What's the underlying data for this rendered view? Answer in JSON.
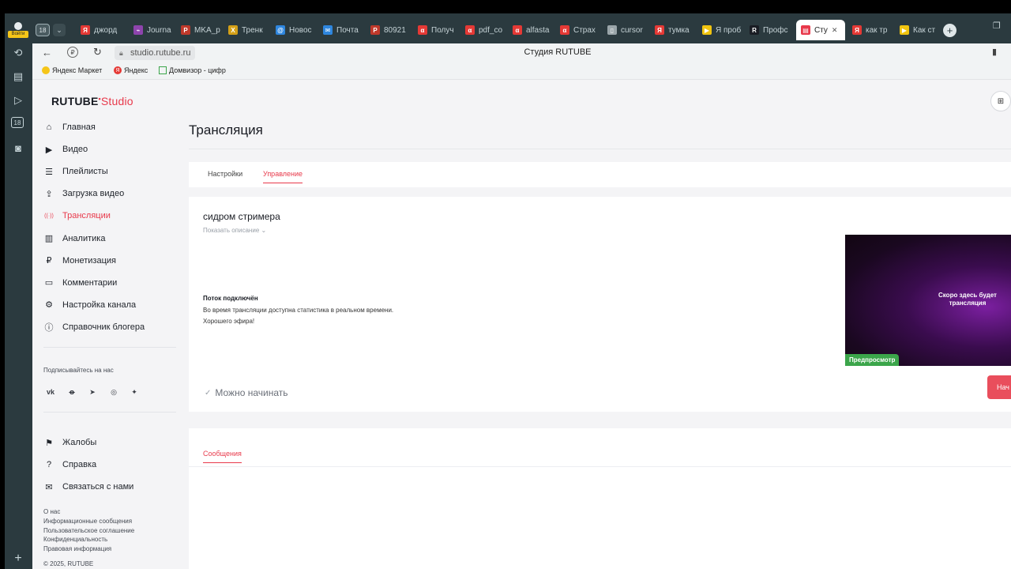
{
  "browser": {
    "profile_label": "Войти",
    "tab_counter": "18",
    "tabs": [
      {
        "label": "джорд",
        "icon": "yandex-icon",
        "color": "#e53935"
      },
      {
        "label": "Journa",
        "icon": "journal-icon",
        "color": "#8e44ad"
      },
      {
        "label": "MKA_р",
        "icon": "pdf-icon",
        "color": "#c0392b"
      },
      {
        "label": "Тренк",
        "icon": "translate-icon",
        "color": "#d4a017"
      },
      {
        "label": "Новос",
        "icon": "at-icon",
        "color": "#2e86de"
      },
      {
        "label": "Почта",
        "icon": "mail-icon",
        "color": "#2e86de"
      },
      {
        "label": "80921",
        "icon": "pdf-icon",
        "color": "#c0392b"
      },
      {
        "label": "Получ",
        "icon": "alfa-icon",
        "color": "#e53935"
      },
      {
        "label": "pdf_co",
        "icon": "alfa-icon",
        "color": "#e53935"
      },
      {
        "label": "alfasta",
        "icon": "alfa-icon",
        "color": "#e53935"
      },
      {
        "label": "Страх",
        "icon": "alfa-icon",
        "color": "#e53935"
      },
      {
        "label": "cursor",
        "icon": "doc-icon",
        "color": "#9aa5a9"
      },
      {
        "label": "тумка",
        "icon": "yandex-icon",
        "color": "#e53935"
      },
      {
        "label": "Я проб",
        "icon": "play-icon",
        "color": "#f1c40f"
      },
      {
        "label": "Профс",
        "icon": "r-icon",
        "color": "#1a1d24"
      },
      {
        "label": "Сту",
        "icon": "studio-icon",
        "color": "#e8394b",
        "active": true
      },
      {
        "label": "как тр",
        "icon": "yandex-icon",
        "color": "#e53935"
      },
      {
        "label": "Как ст",
        "icon": "play-icon",
        "color": "#f1c40f"
      }
    ],
    "url": "studio.rutube.ru",
    "page_title": "Студия RUTUBE",
    "bookmarks": [
      {
        "label": "Яндекс Маркет",
        "icon": "market-icon"
      },
      {
        "label": "Яндекс",
        "icon": "yandex-icon"
      },
      {
        "label": "Домвизор - цифр",
        "icon": "house-icon"
      }
    ]
  },
  "sidebar": {
    "logo_main": "RUTUBE",
    "logo_studio": "Studio",
    "nav": [
      {
        "label": "Главная",
        "icon": "home-icon"
      },
      {
        "label": "Видео",
        "icon": "video-icon"
      },
      {
        "label": "Плейлисты",
        "icon": "playlist-icon"
      },
      {
        "label": "Загрузка видео",
        "icon": "upload-icon"
      },
      {
        "label": "Трансляции",
        "icon": "broadcast-icon",
        "active": true
      },
      {
        "label": "Аналитика",
        "icon": "analytics-icon"
      },
      {
        "label": "Монетизация",
        "icon": "ruble-icon"
      },
      {
        "label": "Комментарии",
        "icon": "comment-icon"
      },
      {
        "label": "Настройка канала",
        "icon": "gear-icon"
      },
      {
        "label": "Справочник блогера",
        "icon": "info-icon"
      }
    ],
    "social_title": "Подписывайтесь на нас",
    "social": [
      "vk-icon",
      "ok-icon",
      "telegram-icon",
      "viber-icon",
      "plus-icon"
    ],
    "bottom_nav": [
      {
        "label": "Жалобы",
        "icon": "flag-icon"
      },
      {
        "label": "Справка",
        "icon": "help-icon"
      },
      {
        "label": "Связаться с нами",
        "icon": "mail-icon"
      }
    ],
    "links": [
      "О нас",
      "Информационные сообщения",
      "Пользовательское соглашение",
      "Конфиденциальность",
      "Правовая информация"
    ],
    "copyright": "© 2025, RUTUBE"
  },
  "main": {
    "title": "Трансляция",
    "tabs": [
      "Настройки",
      "Управление"
    ],
    "active_tab": "Управление",
    "stream_title": "сидром стримера",
    "show_description": "Показать описание",
    "status_title": "Поток подключён",
    "status_line1": "Во время трансляции доступна статистика в реальном времени.",
    "status_line2": "Хорошего эфира!",
    "ready_label": "Можно начинать",
    "start_button": "Нач",
    "preview_text": "Скоро здесь будет трансляция",
    "preview_badge": "Предпросмотр",
    "messages_tab": "Сообщения",
    "accent": "#e8394b"
  }
}
